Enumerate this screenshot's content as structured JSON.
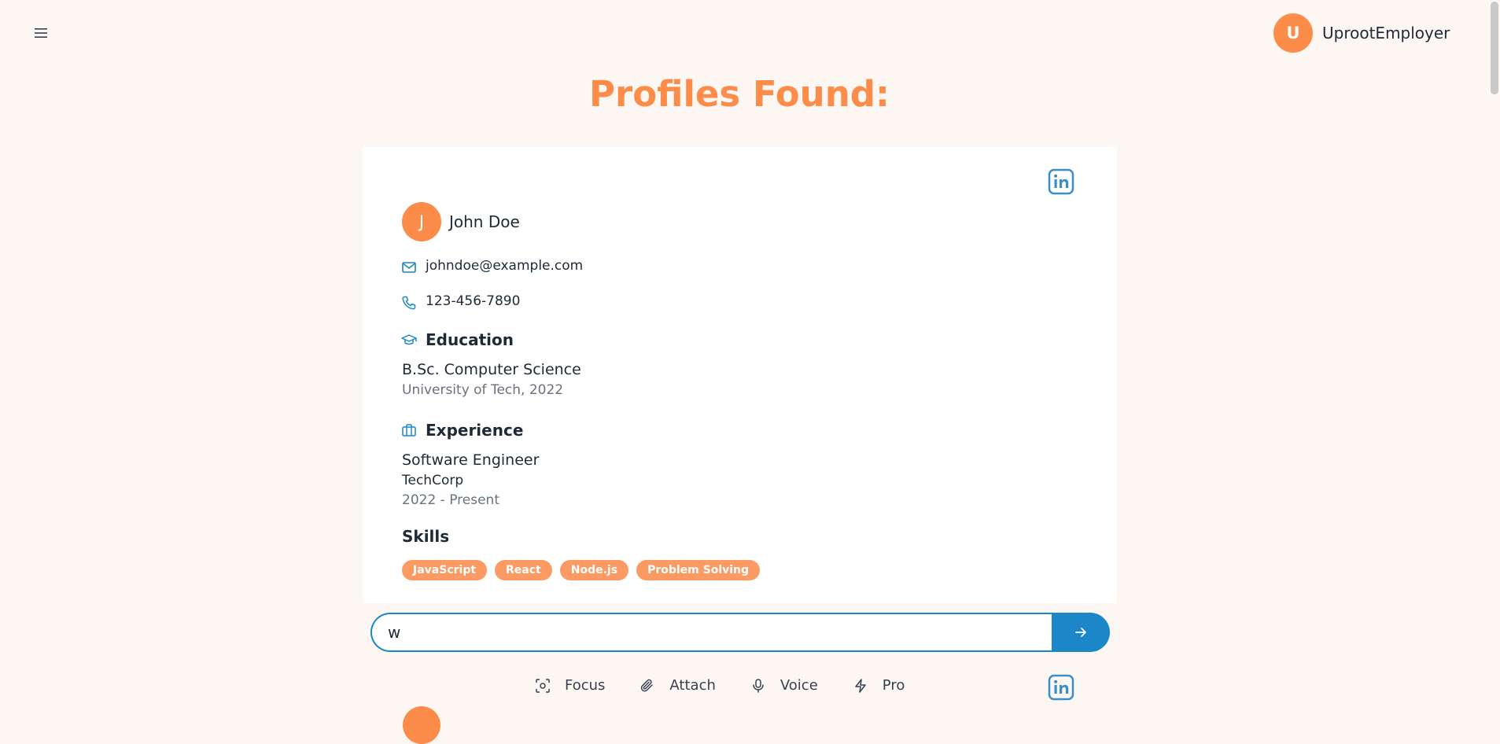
{
  "header": {
    "menu_icon": "hamburger-icon",
    "user": {
      "initial": "U",
      "name": "UprootEmployer"
    }
  },
  "page_title": "Profiles Found:",
  "profile": {
    "initial": "J",
    "name": "John Doe",
    "email": "johndoe@example.com",
    "phone": "123-456-7890",
    "education": {
      "heading": "Education",
      "degree": "B.Sc. Computer Science",
      "school": "University of Tech, 2022"
    },
    "experience": {
      "heading": "Experience",
      "title": "Software Engineer",
      "company": "TechCorp",
      "period": "2022 - Present"
    },
    "skills": {
      "heading": "Skills",
      "items": [
        "JavaScript",
        "React",
        "Node.js",
        "Problem Solving"
      ]
    }
  },
  "chat": {
    "input_value": "w"
  },
  "toolbar": {
    "focus": "Focus",
    "attach": "Attach",
    "voice": "Voice",
    "pro": "Pro"
  },
  "colors": {
    "accent_orange": "#fb8c4a",
    "accent_blue": "#1b87c9",
    "background": "#fdf7f3"
  }
}
